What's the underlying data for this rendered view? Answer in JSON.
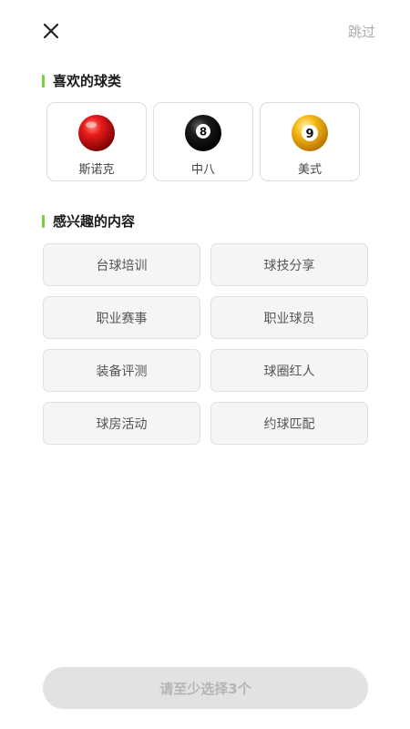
{
  "header": {
    "close_icon": "close-icon",
    "skip_label": "跳过"
  },
  "ball_section": {
    "title": "喜欢的球类",
    "accent_color": "#7ccf3c",
    "items": [
      {
        "label": "斯诺克",
        "icon": "red-snooker-ball-icon"
      },
      {
        "label": "中八",
        "icon": "black-eight-ball-icon",
        "ball_text": "8"
      },
      {
        "label": "美式",
        "icon": "yellow-nine-ball-icon",
        "ball_text": "9"
      }
    ]
  },
  "interest_section": {
    "title": "感兴趣的内容",
    "items": [
      {
        "label": "台球培训"
      },
      {
        "label": "球技分享"
      },
      {
        "label": "职业赛事"
      },
      {
        "label": "职业球员"
      },
      {
        "label": "装备评测"
      },
      {
        "label": "球圈红人"
      },
      {
        "label": "球房活动"
      },
      {
        "label": "约球匹配"
      }
    ]
  },
  "footer": {
    "submit_label": "请至少选择3个",
    "disabled": true
  }
}
